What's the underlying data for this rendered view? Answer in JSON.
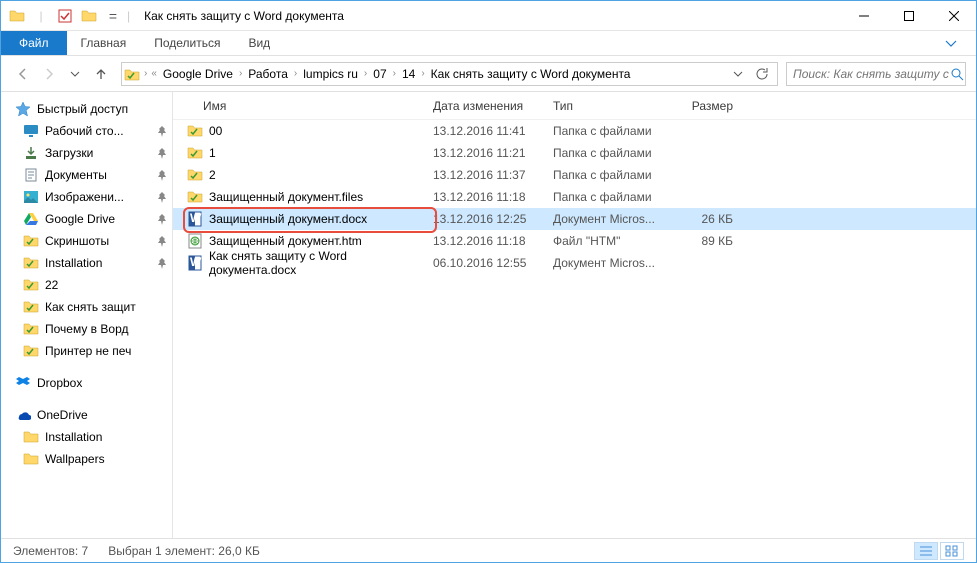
{
  "window": {
    "title": "Как снять защиту с Word документа"
  },
  "ribbon": {
    "file": "Файл",
    "tabs": [
      "Главная",
      "Поделиться",
      "Вид"
    ]
  },
  "breadcrumbs": [
    "Google Drive",
    "Работа",
    "lumpics ru",
    "07",
    "14",
    "Как снять защиту с Word документа"
  ],
  "search": {
    "placeholder": "Поиск: Как снять защиту с ..."
  },
  "columns": {
    "name": "Имя",
    "modified": "Дата изменения",
    "type": "Тип",
    "size": "Размер"
  },
  "sidebar": {
    "quick": "Быстрый доступ",
    "quick_items": [
      {
        "label": "Рабочий сто...",
        "icon": "desktop",
        "pinned": true
      },
      {
        "label": "Загрузки",
        "icon": "downloads",
        "pinned": true
      },
      {
        "label": "Документы",
        "icon": "documents",
        "pinned": true
      },
      {
        "label": "Изображени...",
        "icon": "pictures",
        "pinned": true
      },
      {
        "label": "Google Drive",
        "icon": "gdrive",
        "pinned": true
      },
      {
        "label": "Скриншоты",
        "icon": "folder",
        "pinned": true
      },
      {
        "label": "Installation",
        "icon": "folder",
        "pinned": true
      },
      {
        "label": "22",
        "icon": "folder",
        "pinned": false
      },
      {
        "label": "Как снять защит",
        "icon": "folder",
        "pinned": false
      },
      {
        "label": "Почему в Ворд",
        "icon": "folder",
        "pinned": false
      },
      {
        "label": "Принтер не печ",
        "icon": "folder",
        "pinned": false
      }
    ],
    "dropbox": "Dropbox",
    "onedrive": "OneDrive",
    "onedrive_items": [
      {
        "label": "Installation"
      },
      {
        "label": "Wallpapers"
      }
    ]
  },
  "files": [
    {
      "name": "00",
      "date": "13.12.2016 11:41",
      "type": "Папка с файлами",
      "size": "",
      "icon": "folder"
    },
    {
      "name": "1",
      "date": "13.12.2016 11:21",
      "type": "Папка с файлами",
      "size": "",
      "icon": "folder"
    },
    {
      "name": "2",
      "date": "13.12.2016 11:37",
      "type": "Папка с файлами",
      "size": "",
      "icon": "folder"
    },
    {
      "name": "Защищенный документ.files",
      "date": "13.12.2016 11:18",
      "type": "Папка с файлами",
      "size": "",
      "icon": "folder"
    },
    {
      "name": "Защищенный документ.docx",
      "date": "13.12.2016 12:25",
      "type": "Документ Micros...",
      "size": "26 КБ",
      "icon": "docx",
      "selected": true
    },
    {
      "name": "Защищенный документ.htm",
      "date": "13.12.2016 11:18",
      "type": "Файл \"HTM\"",
      "size": "89 КБ",
      "icon": "htm"
    },
    {
      "name": "Как снять защиту с Word документа.docx",
      "date": "06.10.2016 12:55",
      "type": "Документ Micros...",
      "size": "",
      "icon": "docx"
    }
  ],
  "status": {
    "count": "Элементов: 7",
    "selection": "Выбран 1 элемент: 26,0 КБ"
  }
}
